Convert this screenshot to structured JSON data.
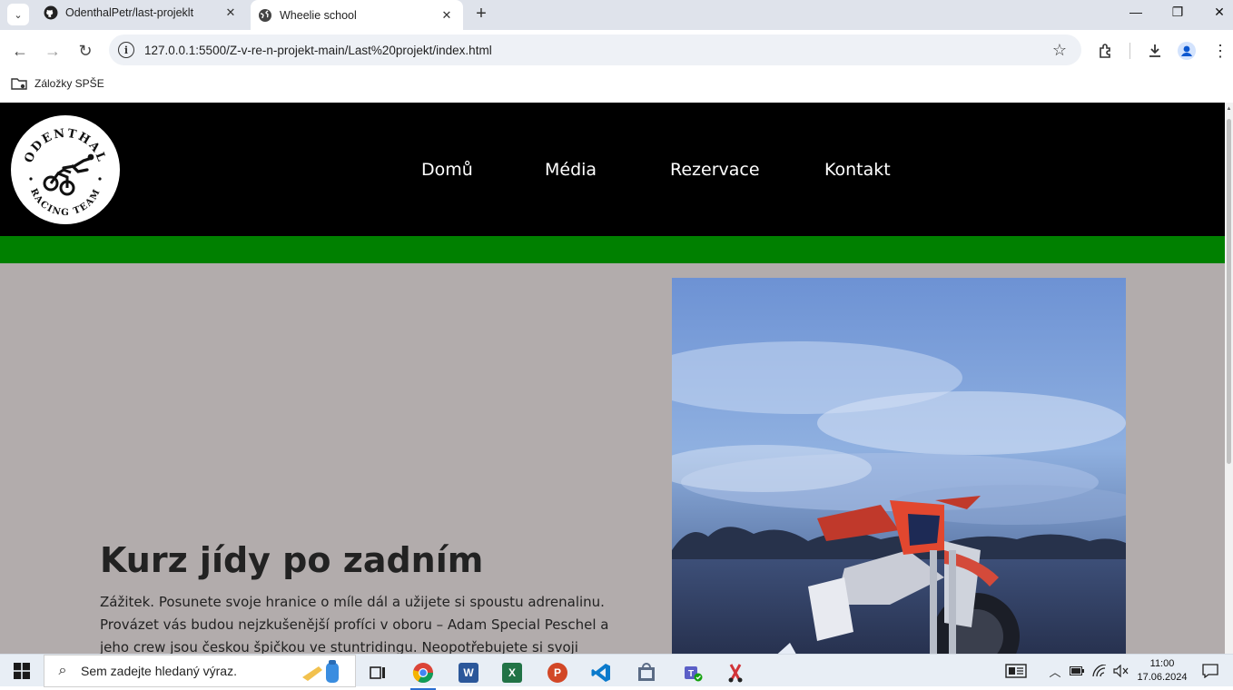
{
  "browser": {
    "tabs": [
      {
        "title": "OdenthalPetr/last-projeklt",
        "icon": "github-icon",
        "active": false
      },
      {
        "title": "Wheelie school",
        "icon": "globe-icon",
        "active": true
      }
    ],
    "url": "127.0.0.1:5500/Z-v-re-n-projekt-main/Last%20projekt/index.html",
    "bookmark_label": "Záložky SPŠE"
  },
  "site": {
    "logo": {
      "top_text": "ODENTHAL",
      "bottom_text": "RACING TEAM"
    },
    "nav": [
      "Domů",
      "Média",
      "Rezervace",
      "Kontakt"
    ],
    "hero": {
      "title": "Kurz jídy po zadním",
      "text": "Zážitek. Posunete svoje hranice o míle dál a užijete si spoustu adrenalinu. Provázet vás budou nejzkušenější profíci v oboru – Adam Special Peschel a jeho crew jsou českou špičkou ve stuntridingu. Neopotřebujete si svoji motorku. Veškerou výuku"
    },
    "colors": {
      "header": "#000000",
      "accent_bar": "#008000",
      "page_bg": "#b2acac"
    }
  },
  "taskbar": {
    "search_placeholder": "Sem zadejte hledaný výraz.",
    "time": "11:00",
    "date": "17.06.2024"
  }
}
